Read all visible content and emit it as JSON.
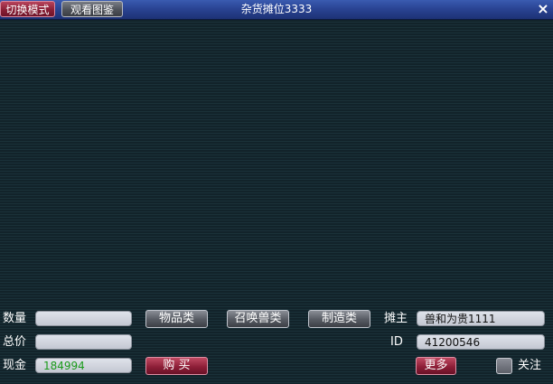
{
  "titlebar": {
    "title": "杂货摊位3333",
    "switch_mode_label": "切换模式",
    "view_atlas_label": "观看图鉴",
    "close_label": "×"
  },
  "form": {
    "quantity_label": "数量",
    "quantity_value": "",
    "total_price_label": "总价",
    "total_price_value": "",
    "cash_label": "现金",
    "cash_value": "184994"
  },
  "category_buttons": {
    "items": "物品类",
    "summon_beasts": "召唤兽类",
    "crafting": "制造类"
  },
  "buy_button": "购 买",
  "owner": {
    "owner_label": "摊主",
    "owner_value": "兽和为贵1111",
    "id_label": "ID",
    "id_value": "41200546"
  },
  "more_button": "更多",
  "follow": {
    "label": "关注",
    "checked": false
  },
  "colors": {
    "title_bar": "#2a4494",
    "background": "#162b33",
    "red_button": "#8e1f38",
    "gray_button": "#5a5e66",
    "cash_text": "#1b9b1b"
  }
}
